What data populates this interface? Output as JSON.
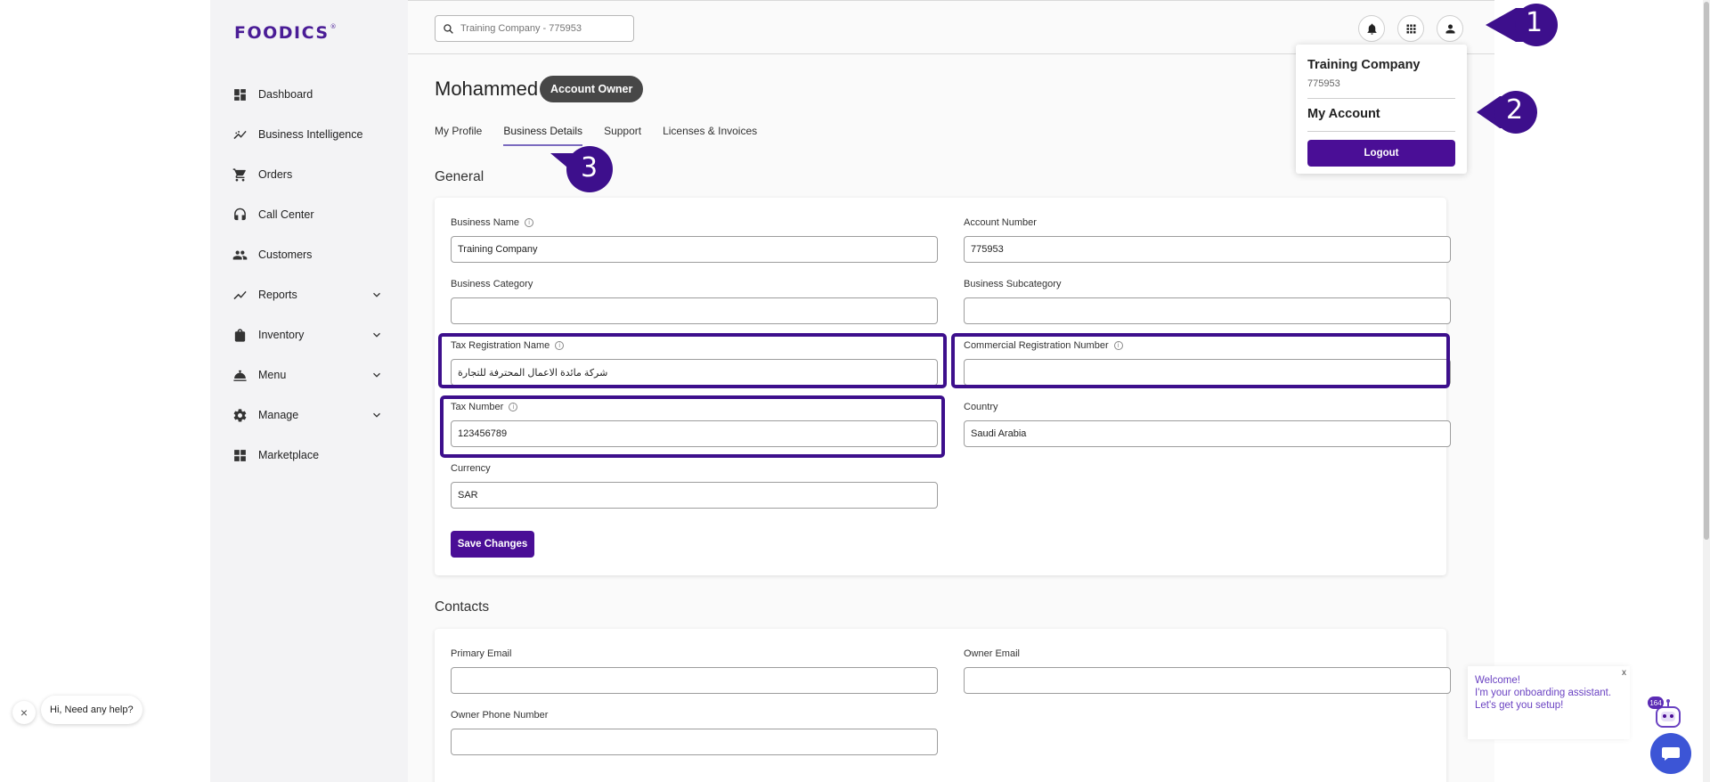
{
  "brand": {
    "logo_text": "FOODICS",
    "logo_mark": "®",
    "accent": "#4a0e96"
  },
  "sidebar": {
    "items": [
      {
        "label": "Dashboard",
        "icon": "dashboard-icon"
      },
      {
        "label": "Business Intelligence",
        "icon": "trending-icon"
      },
      {
        "label": "Orders",
        "icon": "cart-icon"
      },
      {
        "label": "Call Center",
        "icon": "headset-icon"
      },
      {
        "label": "Customers",
        "icon": "people-icon"
      },
      {
        "label": "Reports",
        "icon": "chart-line-icon",
        "expandable": true
      },
      {
        "label": "Inventory",
        "icon": "bag-icon",
        "expandable": true
      },
      {
        "label": "Menu",
        "icon": "menu-food-icon",
        "expandable": true
      },
      {
        "label": "Manage",
        "icon": "gear-icon",
        "expandable": true
      },
      {
        "label": "Marketplace",
        "icon": "apps-icon"
      }
    ]
  },
  "topbar": {
    "search_placeholder": "Training Company - 775953",
    "buttons": [
      "bell-icon",
      "grid-icon",
      "person-icon"
    ]
  },
  "profile": {
    "name": "Mohammed",
    "role_badge": "Account Owner"
  },
  "tabs": [
    {
      "label": "My Profile",
      "active": false
    },
    {
      "label": "Business Details",
      "active": true
    },
    {
      "label": "Support",
      "active": false
    },
    {
      "label": "Licenses & Invoices",
      "active": false
    }
  ],
  "general": {
    "title": "General",
    "business_name": {
      "label": "Business Name",
      "value": "Training Company"
    },
    "account_number": {
      "label": "Account Number",
      "value": "775953"
    },
    "business_category": {
      "label": "Business Category",
      "value": ""
    },
    "business_subcategory": {
      "label": "Business Subcategory",
      "value": ""
    },
    "tax_registration_name": {
      "label": "Tax Registration Name",
      "value": "شركة مائدة الاعمال المحترفة للتجارة"
    },
    "commercial_registration_number": {
      "label": "Commercial Registration Number",
      "value": ""
    },
    "tax_number": {
      "label": "Tax Number",
      "value": "123456789"
    },
    "country": {
      "label": "Country",
      "value": "Saudi Arabia"
    },
    "currency": {
      "label": "Currency",
      "value": "SAR"
    },
    "save_label": "Save Changes"
  },
  "contacts": {
    "title": "Contacts",
    "primary_email": {
      "label": "Primary Email",
      "value": ""
    },
    "owner_email": {
      "label": "Owner Email",
      "value": ""
    },
    "owner_phone": {
      "label": "Owner Phone Number",
      "value": ""
    }
  },
  "account_menu": {
    "company_name": "Training Company",
    "company_number": "775953",
    "my_account": "My Account",
    "logout": "Logout"
  },
  "callouts": [
    "1",
    "2",
    "3"
  ],
  "help": {
    "close": "×",
    "text": "Hi, Need any help?"
  },
  "onboarding": {
    "line1": "Welcome!",
    "line2": "I'm your onboarding assistant.",
    "line3": "Let's get you setup!",
    "close": "x",
    "badge": "164"
  }
}
